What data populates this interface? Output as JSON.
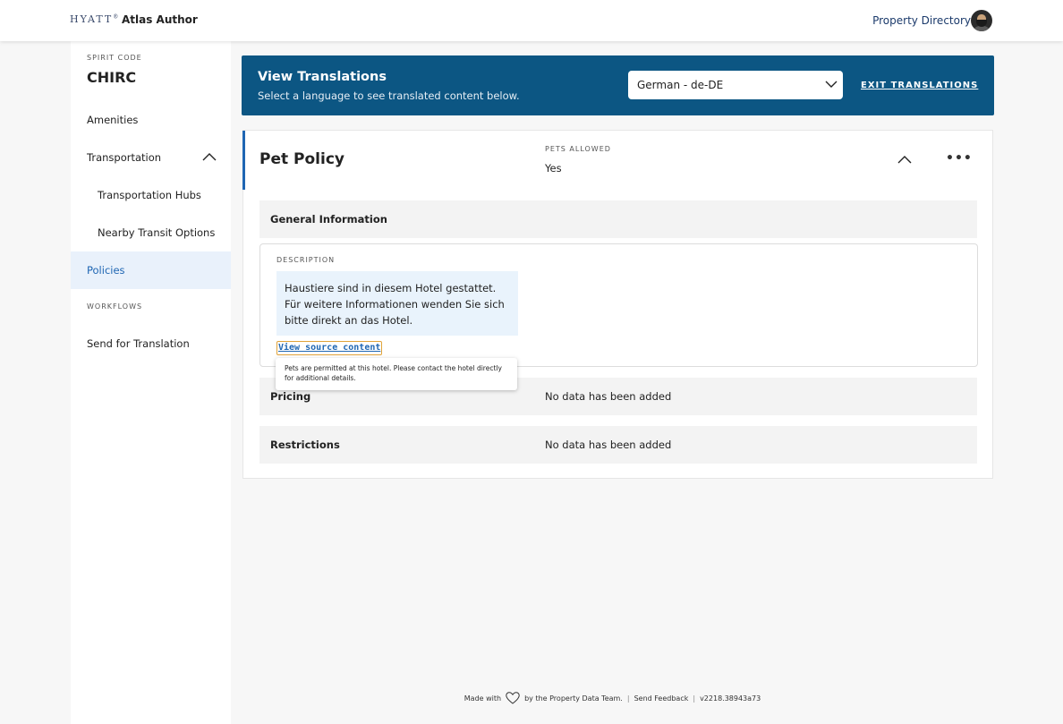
{
  "header": {
    "logo": "HYATT",
    "app_title": "Atlas Author",
    "property_directory": "Property Directory"
  },
  "sidebar": {
    "spirit_code_label": "SPIRIT CODE",
    "spirit_code": "CHIRC",
    "items": [
      {
        "label": "Amenities"
      },
      {
        "label": "Transportation"
      },
      {
        "label": "Transportation Hubs"
      },
      {
        "label": "Nearby Transit Options"
      },
      {
        "label": "Policies"
      }
    ],
    "workflows_label": "WORKFLOWS",
    "workflow_items": [
      {
        "label": "Send for Translation"
      }
    ]
  },
  "banner": {
    "title": "View Translations",
    "subtitle": "Select a language to see translated content below.",
    "language_selected": "German - de-DE",
    "exit_label": "EXIT TRANSLATIONS"
  },
  "card": {
    "title": "Pet Policy",
    "pets_allowed_label": "PETS ALLOWED",
    "pets_allowed_value": "Yes",
    "general_info_label": "General Information",
    "description_label": "DESCRIPTION",
    "description_text": "Haustiere sind in diesem Hotel gestattet. Für weitere Informationen wenden Sie sich bitte direkt an das Hotel.",
    "view_source_label": "View source content",
    "source_tooltip": "Pets are permitted at this hotel. Please contact the hotel directly for additional details.",
    "pricing_label": "Pricing",
    "pricing_value": "No data has been added",
    "restrictions_label": "Restrictions",
    "restrictions_value": "No data has been added"
  },
  "footer": {
    "made_with": "Made with",
    "by_team": "by the Property Data Team.",
    "feedback": "Send Feedback",
    "version": "v2218.38943a73"
  },
  "colors": {
    "banner": "#0c5683",
    "accent": "#1f66b3",
    "active_bg": "#e9f1fb"
  }
}
